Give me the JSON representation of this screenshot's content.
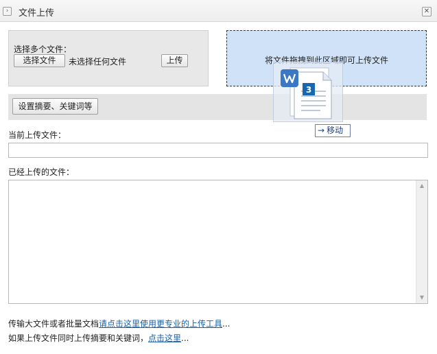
{
  "window": {
    "title": "文件上传",
    "title_icon": "›",
    "close_icon": "✕"
  },
  "select_panel": {
    "label": "选择多个文件：",
    "choose_button": "选择文件",
    "no_file_text": "未选择任何文件",
    "upload_button": "上传"
  },
  "dropzone": {
    "text": "将文件拖拽到此区域即可上传文件"
  },
  "settings": {
    "button": "设置摘要、关键词等"
  },
  "current_upload": {
    "label": "当前上传文件：",
    "value": ""
  },
  "uploaded": {
    "label": "已经上传的文件："
  },
  "footer": {
    "line1_prefix": "传输大文件或者批量文档",
    "line1_link": "请点击这里使用更专业的上传工具",
    "line1_suffix": "...",
    "line2_prefix": "如果上传文件同时上传摘要和关键词，",
    "line2_link": "点击这里",
    "line2_suffix": "..."
  },
  "drag": {
    "badge": "3",
    "move_label": "移动"
  },
  "colors": {
    "dropzone_bg": "#cfe2f8",
    "link": "#1b5fa6",
    "doc_badge": "#1668b3"
  }
}
